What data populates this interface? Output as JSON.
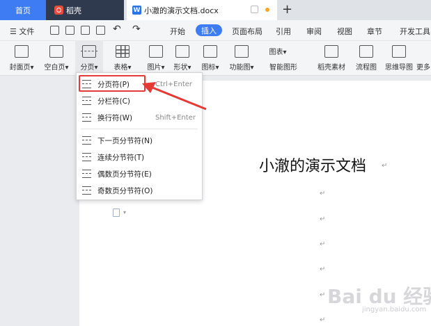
{
  "tabs": {
    "home": "首页",
    "daoke": "稻壳",
    "doc": "小澈的演示文档.docx",
    "add": "+"
  },
  "menu": {
    "file": "☰ 文件",
    "undo": "↶",
    "redo": "↷",
    "tabs": [
      "开始",
      "插入",
      "页面布局",
      "引用",
      "审阅",
      "视图",
      "章节",
      "开发工具"
    ]
  },
  "ribbon": [
    {
      "label": "封面页▾",
      "icon": "cover-page-icon"
    },
    {
      "label": "空白页▾",
      "icon": "blank-page-icon"
    },
    {
      "label": "分页▾",
      "icon": "page-break-icon"
    },
    {
      "label": "表格▾",
      "icon": "table-icon"
    },
    {
      "label": "图片▾",
      "icon": "picture-icon"
    },
    {
      "label": "形状▾",
      "icon": "shape-icon"
    },
    {
      "label": "图标▾",
      "icon": "icons-icon"
    },
    {
      "label": "功能图▾",
      "icon": "function-chart-icon"
    },
    {
      "label": "图表▾",
      "icon": "chart-icon"
    },
    {
      "label": "智能图形",
      "icon": "smart-art-icon"
    },
    {
      "label": "稻壳素材",
      "icon": "daoke-material-icon"
    },
    {
      "label": "流程图",
      "icon": "flowchart-icon"
    },
    {
      "label": "思维导图",
      "icon": "mindmap-icon"
    },
    {
      "label": "更多",
      "icon": "more-icon"
    }
  ],
  "dropdown": {
    "items": [
      {
        "label": "分页符(P)",
        "shortcut": "Ctrl+Enter"
      },
      {
        "label": "分栏符(C)",
        "shortcut": ""
      },
      {
        "label": "换行符(W)",
        "shortcut": "Shift+Enter"
      },
      {
        "label": "下一页分节符(N)",
        "shortcut": ""
      },
      {
        "label": "连续分节符(T)",
        "shortcut": ""
      },
      {
        "label": "偶数页分节符(E)",
        "shortcut": ""
      },
      {
        "label": "奇数页分节符(O)",
        "shortcut": ""
      }
    ]
  },
  "document": {
    "title": "小澈的演示文档",
    "para_mark": "↵"
  },
  "colors": {
    "accent": "#3d7cf2",
    "highlight": "#e53935",
    "daoke_tab": "#2f3a4f"
  },
  "watermark": {
    "brand": "Bai du 经验",
    "url": "jingyan.baidu.com"
  }
}
